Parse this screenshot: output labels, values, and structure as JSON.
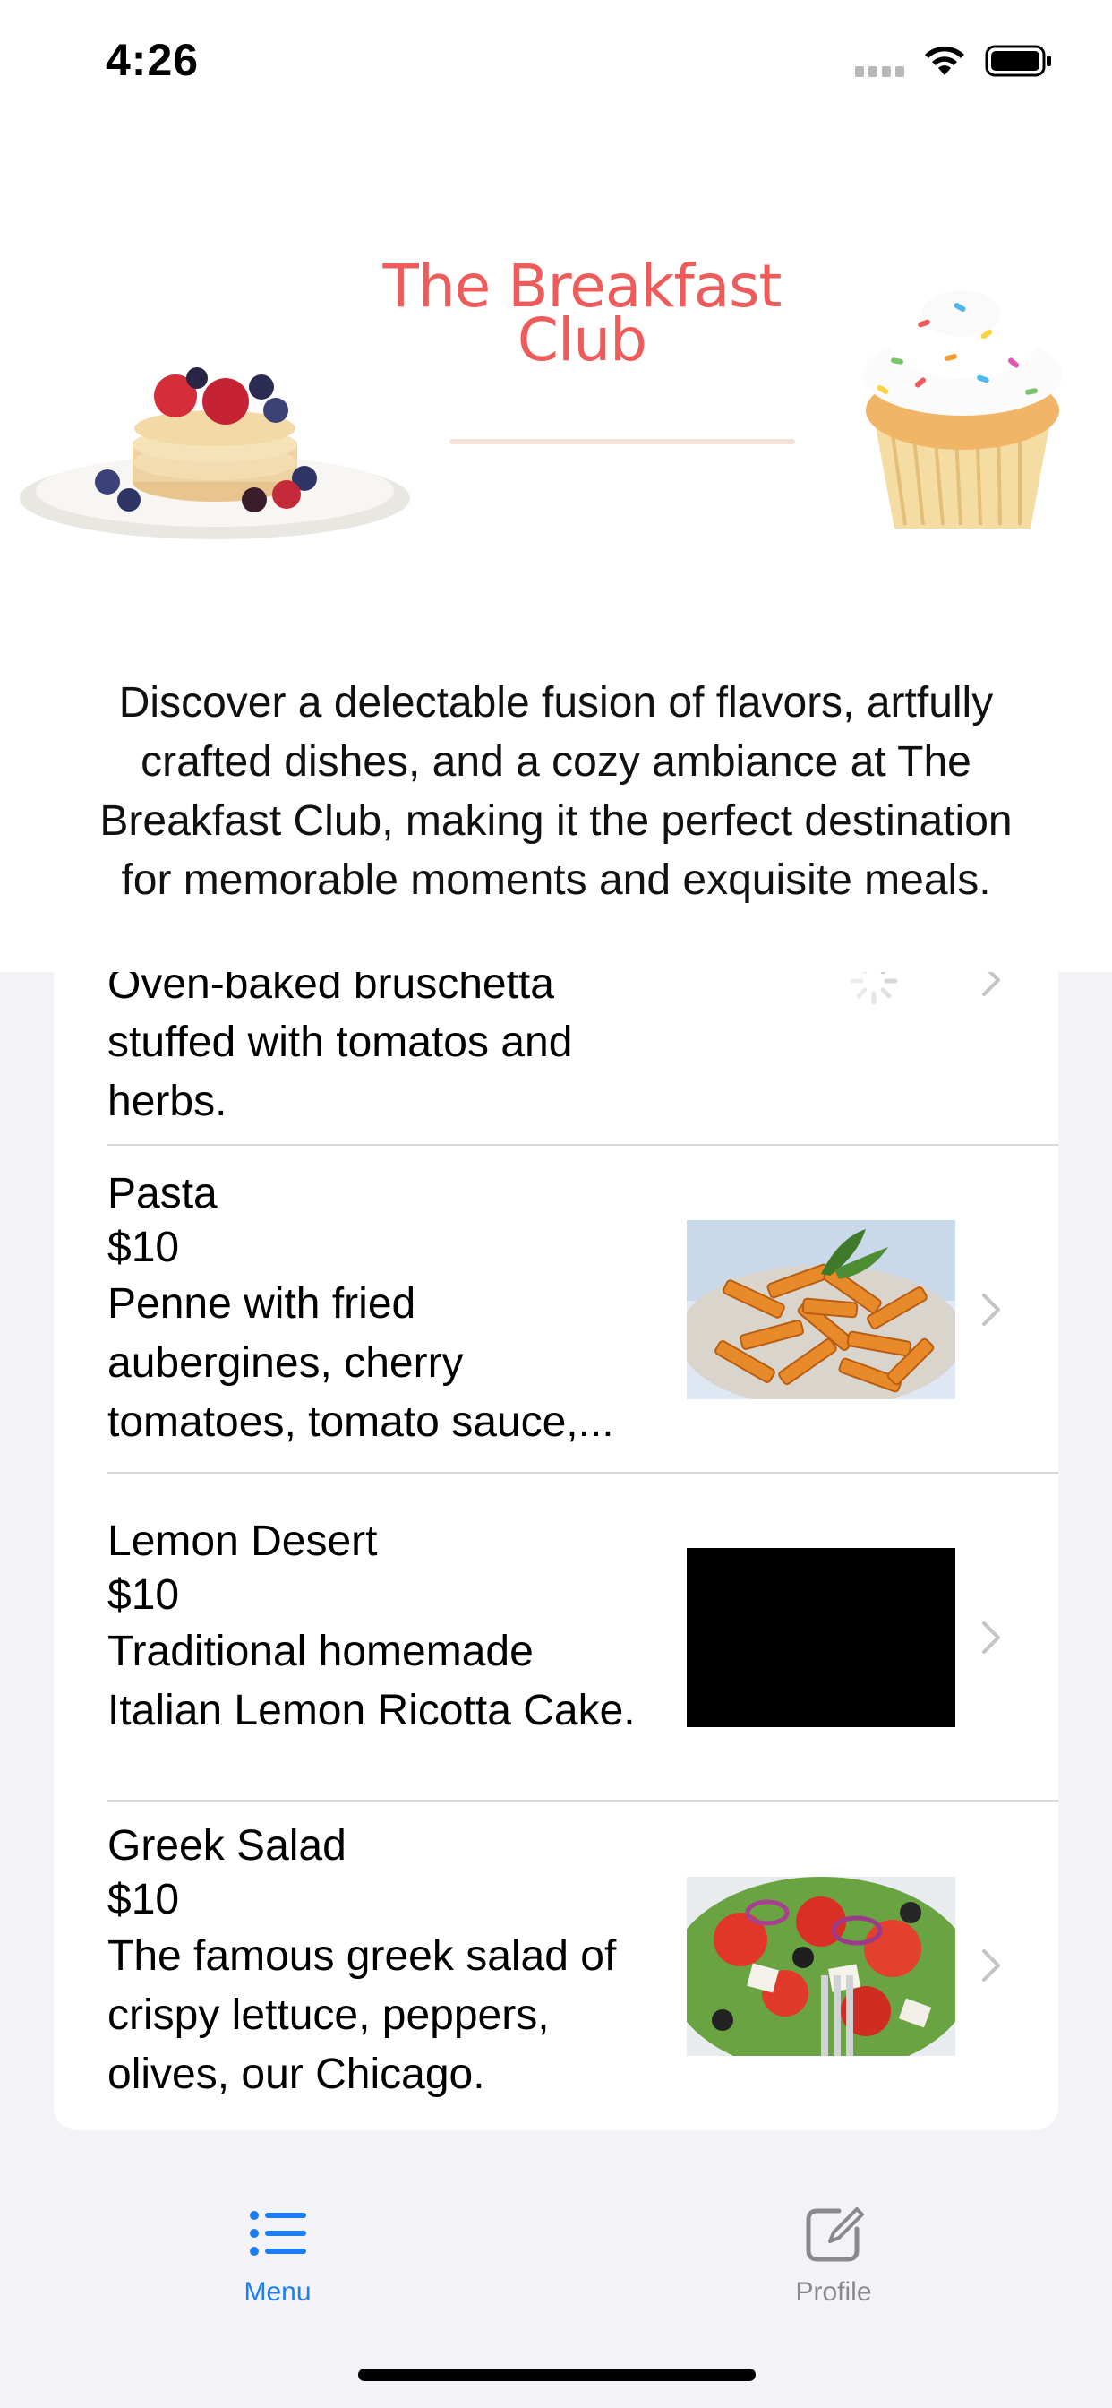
{
  "status_bar": {
    "time": "4:26"
  },
  "header": {
    "brand_title_line1": "The Breakfast",
    "brand_title_line2": "Club",
    "intro_lines": [
      "Discover a delectable fusion of flavors, artfully",
      "crafted dishes, and a cozy ambiance at The",
      "Breakfast Club, making it the perfect destination",
      "for memorable moments and exquisite meals."
    ]
  },
  "menu": {
    "items": [
      {
        "lines": [
          "Oven-baked bruschetta",
          "stuffed with tomatos and",
          "herbs."
        ],
        "image": "loading-spinner"
      },
      {
        "title": "Pasta",
        "price": "$10",
        "desc_lines": [
          "Penne with fried",
          "aubergines, cherry",
          "tomatoes, tomato sauce,..."
        ],
        "image": "pasta-image"
      },
      {
        "title": "Lemon Desert",
        "price": "$10",
        "desc_lines": [
          "Traditional homemade",
          "Italian Lemon Ricotta Cake."
        ],
        "image": "black-placeholder-image"
      },
      {
        "title": "Greek Salad",
        "price": "$10",
        "desc_lines": [
          "The famous greek salad of",
          "crispy lettuce, peppers,",
          "olives, our Chicago."
        ],
        "image": "salad-image"
      }
    ]
  },
  "tab_bar": {
    "tabs": [
      {
        "label": "Menu",
        "icon": "list-icon",
        "selected": true
      },
      {
        "label": "Profile",
        "icon": "edit-icon",
        "selected": false
      }
    ]
  },
  "colors": {
    "brand": "#ee5b5b",
    "accent": "#1c7ef2",
    "inactive": "#8a8a8e"
  }
}
